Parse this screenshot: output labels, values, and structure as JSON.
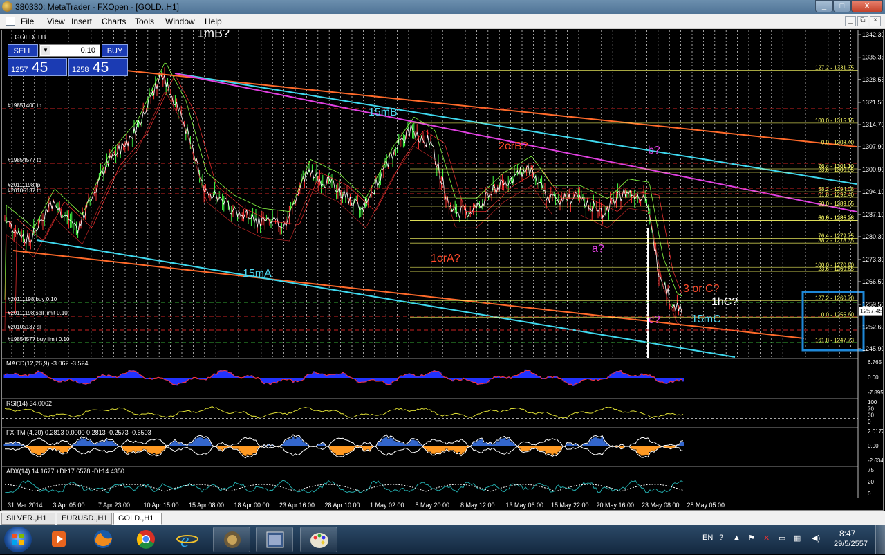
{
  "window": {
    "title": "380330: MetaTrader - FXOpen - [GOLD.,H1]",
    "buttons": [
      "_",
      "□",
      "X"
    ]
  },
  "menu": {
    "items": [
      "File",
      "View",
      "Insert",
      "Charts",
      "Tools",
      "Window",
      "Help"
    ],
    "mdi_buttons": [
      "_",
      "⧉",
      "×"
    ]
  },
  "chart": {
    "symbol": "GOLD.,H1",
    "price_labels": [
      "1342.30",
      "1335.35",
      "1328.55",
      "1321.50",
      "1314.70",
      "1307.90",
      "1300.90",
      "1294.10",
      "1287.10",
      "1280.30",
      "1273.30",
      "1266.50",
      "1259.50",
      "1252.60",
      "1245.90"
    ],
    "current_price": "1257.45",
    "time_labels": [
      "31 Mar 2014",
      "3 Apr 05:00",
      "7 Apr 23:00",
      "10 Apr 15:00",
      "15 Apr 08:00",
      "18 Apr 00:00",
      "23 Apr 16:00",
      "28 Apr 10:00",
      "1 May 02:00",
      "5 May 20:00",
      "8 May 12:00",
      "13 May 06:00",
      "15 May 22:00",
      "20 May 16:00",
      "23 May 08:00",
      "28 May 05:00"
    ],
    "fib_labels": [
      "127.2 - 1331.35",
      "100.0 - 1315.15",
      "0.0 - 1308.40",
      "76.4 - 1301.10",
      "23.6 - 1300.05",
      "38.2 - 1294.08",
      "61.8 - 1292.40",
      "50.0 - 1289.65",
      "50.0 - 1285.28",
      "61.8 - 1285.28",
      "76.4 - 1279.75",
      "38.2 - 1278.35",
      "100.0 - 1270.90",
      "23.6 - 1269.65",
      "127.2 - 1260.70",
      "0.0 - 1255.60",
      "161.8 - 1247.73"
    ],
    "order_labels": [
      "#19851400 tp",
      "#19854577 tp",
      "#20111198 tp",
      "#20105137 tp",
      "#20111198 buy 0.10",
      "#20111198 sell limit 0.10",
      "#20105137 sl",
      "#19854577 buy limit 0.10"
    ],
    "annotations": [
      {
        "text": "1mB?",
        "color": "#ffffff"
      },
      {
        "text": "15mB",
        "color": "#4fd6ee"
      },
      {
        "text": "2orB?",
        "color": "#ff4a2a"
      },
      {
        "text": "b?",
        "color": "#e040e0"
      },
      {
        "text": "a?",
        "color": "#e040e0"
      },
      {
        "text": "1orA?",
        "color": "#ff4a2a"
      },
      {
        "text": "15mA",
        "color": "#4fd6ee"
      },
      {
        "text": "3 or C?",
        "color": "#ff4a2a"
      },
      {
        "text": "1hC?",
        "color": "#ffffff"
      },
      {
        "text": "c?",
        "color": "#e040e0"
      },
      {
        "text": "15mC",
        "color": "#4fd6ee"
      }
    ]
  },
  "trade_panel": {
    "sell_label": "SELL",
    "buy_label": "BUY",
    "lot": "0.10",
    "bid_small": "1257",
    "bid_big": "45",
    "ask_small": "1258",
    "ask_big": "45"
  },
  "indicators": [
    {
      "label": "MACD(12,26,9) -3.062 -3.524",
      "scale": [
        "6.765",
        "0.00",
        "-7.895"
      ]
    },
    {
      "label": "RSI(14) 34.0062",
      "scale": [
        "100",
        "70",
        "30",
        "0"
      ]
    },
    {
      "label": "FX-TM (4,20) 0.2813 0.0000 0.2813 -0.2573 -0.6503",
      "scale": [
        "2.0172",
        "0.00",
        "-2.6345"
      ]
    },
    {
      "label": "ADX(14) 14.1677 +DI:17.6578 -DI:14.4350",
      "scale": [
        "75",
        "20",
        "0"
      ]
    }
  ],
  "tabs": [
    "SILVER.,H1",
    "EURUSD.,H1",
    "GOLD.,H1"
  ],
  "active_tab": "GOLD.,H1",
  "taskbar": {
    "language": "EN",
    "time": "8:47",
    "date": "29/5/2557"
  },
  "colors": {
    "price_channel": "#ff6a2a",
    "cyan_channel": "#3fd8ee",
    "magenta_line": "#e040e0",
    "fib": "#ffff66",
    "highlight_box": "#1e88d8"
  }
}
